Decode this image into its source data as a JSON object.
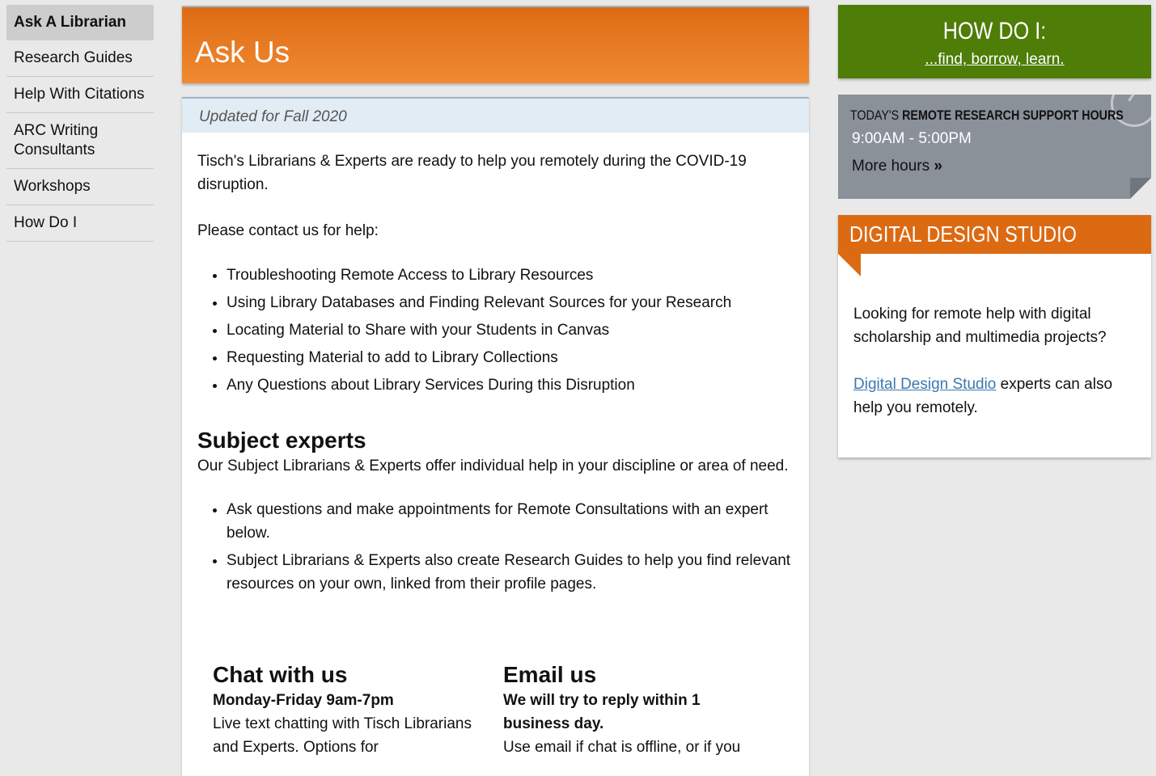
{
  "sidebar": {
    "items": [
      {
        "label": "Ask A Librarian",
        "active": true
      },
      {
        "label": "Research Guides"
      },
      {
        "label": "Help With Citations"
      },
      {
        "label": "ARC Writing Consultants"
      },
      {
        "label": "Workshops"
      },
      {
        "label": "How Do I"
      }
    ]
  },
  "header": {
    "title": "Ask Us"
  },
  "content": {
    "updated": "Updated for Fall 2020",
    "intro": "Tisch's Librarians & Experts are ready to help you remotely during the COVID-19 disruption.",
    "contact": "Please contact us for help:",
    "help_items": [
      "Troubleshooting Remote Access to Library Resources",
      "Using Library Databases and Finding Relevant Sources for your Research",
      "Locating Material to Share with your Students in Canvas",
      "Requesting Material to add to Library Collections",
      "Any Questions about Library Services During this Disruption"
    ],
    "subject_heading": "Subject experts",
    "subject_intro": "Our Subject Librarians & Experts offer individual help in your discipline or area of need.",
    "subject_items": [
      "Ask questions and make appointments for Remote Consultations with an expert below.",
      "Subject Librarians & Experts also create Research Guides to help you find relevant resources on your own, linked from their profile pages."
    ],
    "chat": {
      "heading": "Chat with us",
      "hours": "Monday-Friday 9am-7pm",
      "text": "Live text chatting with Tisch Librarians and Experts. Options for"
    },
    "email": {
      "heading": "Email us",
      "note": "We will try to reply within 1 business day.",
      "text": "Use email if chat is offline, or if you"
    }
  },
  "right": {
    "howdoi": {
      "title": "HOW DO I:",
      "link": "...find, borrow, learn."
    },
    "hours": {
      "label_prefix": "TODAY'S ",
      "label_bold": "REMOTE RESEARCH SUPPORT HOURS",
      "time": "9:00AM - 5:00PM",
      "more": "More hours"
    },
    "dds": {
      "title": "DIGITAL DESIGN STUDIO",
      "text1": "Looking for remote help with digital scholarship and multimedia projects?",
      "link": "Digital Design Studio",
      "text2": " experts can also help you remotely."
    }
  },
  "colors": {
    "orange": "#de6b14",
    "green": "#4e7d08",
    "gray_panel": "#8a9199",
    "link_blue": "#3c78b0",
    "updated_bg": "#e2ecf5"
  }
}
